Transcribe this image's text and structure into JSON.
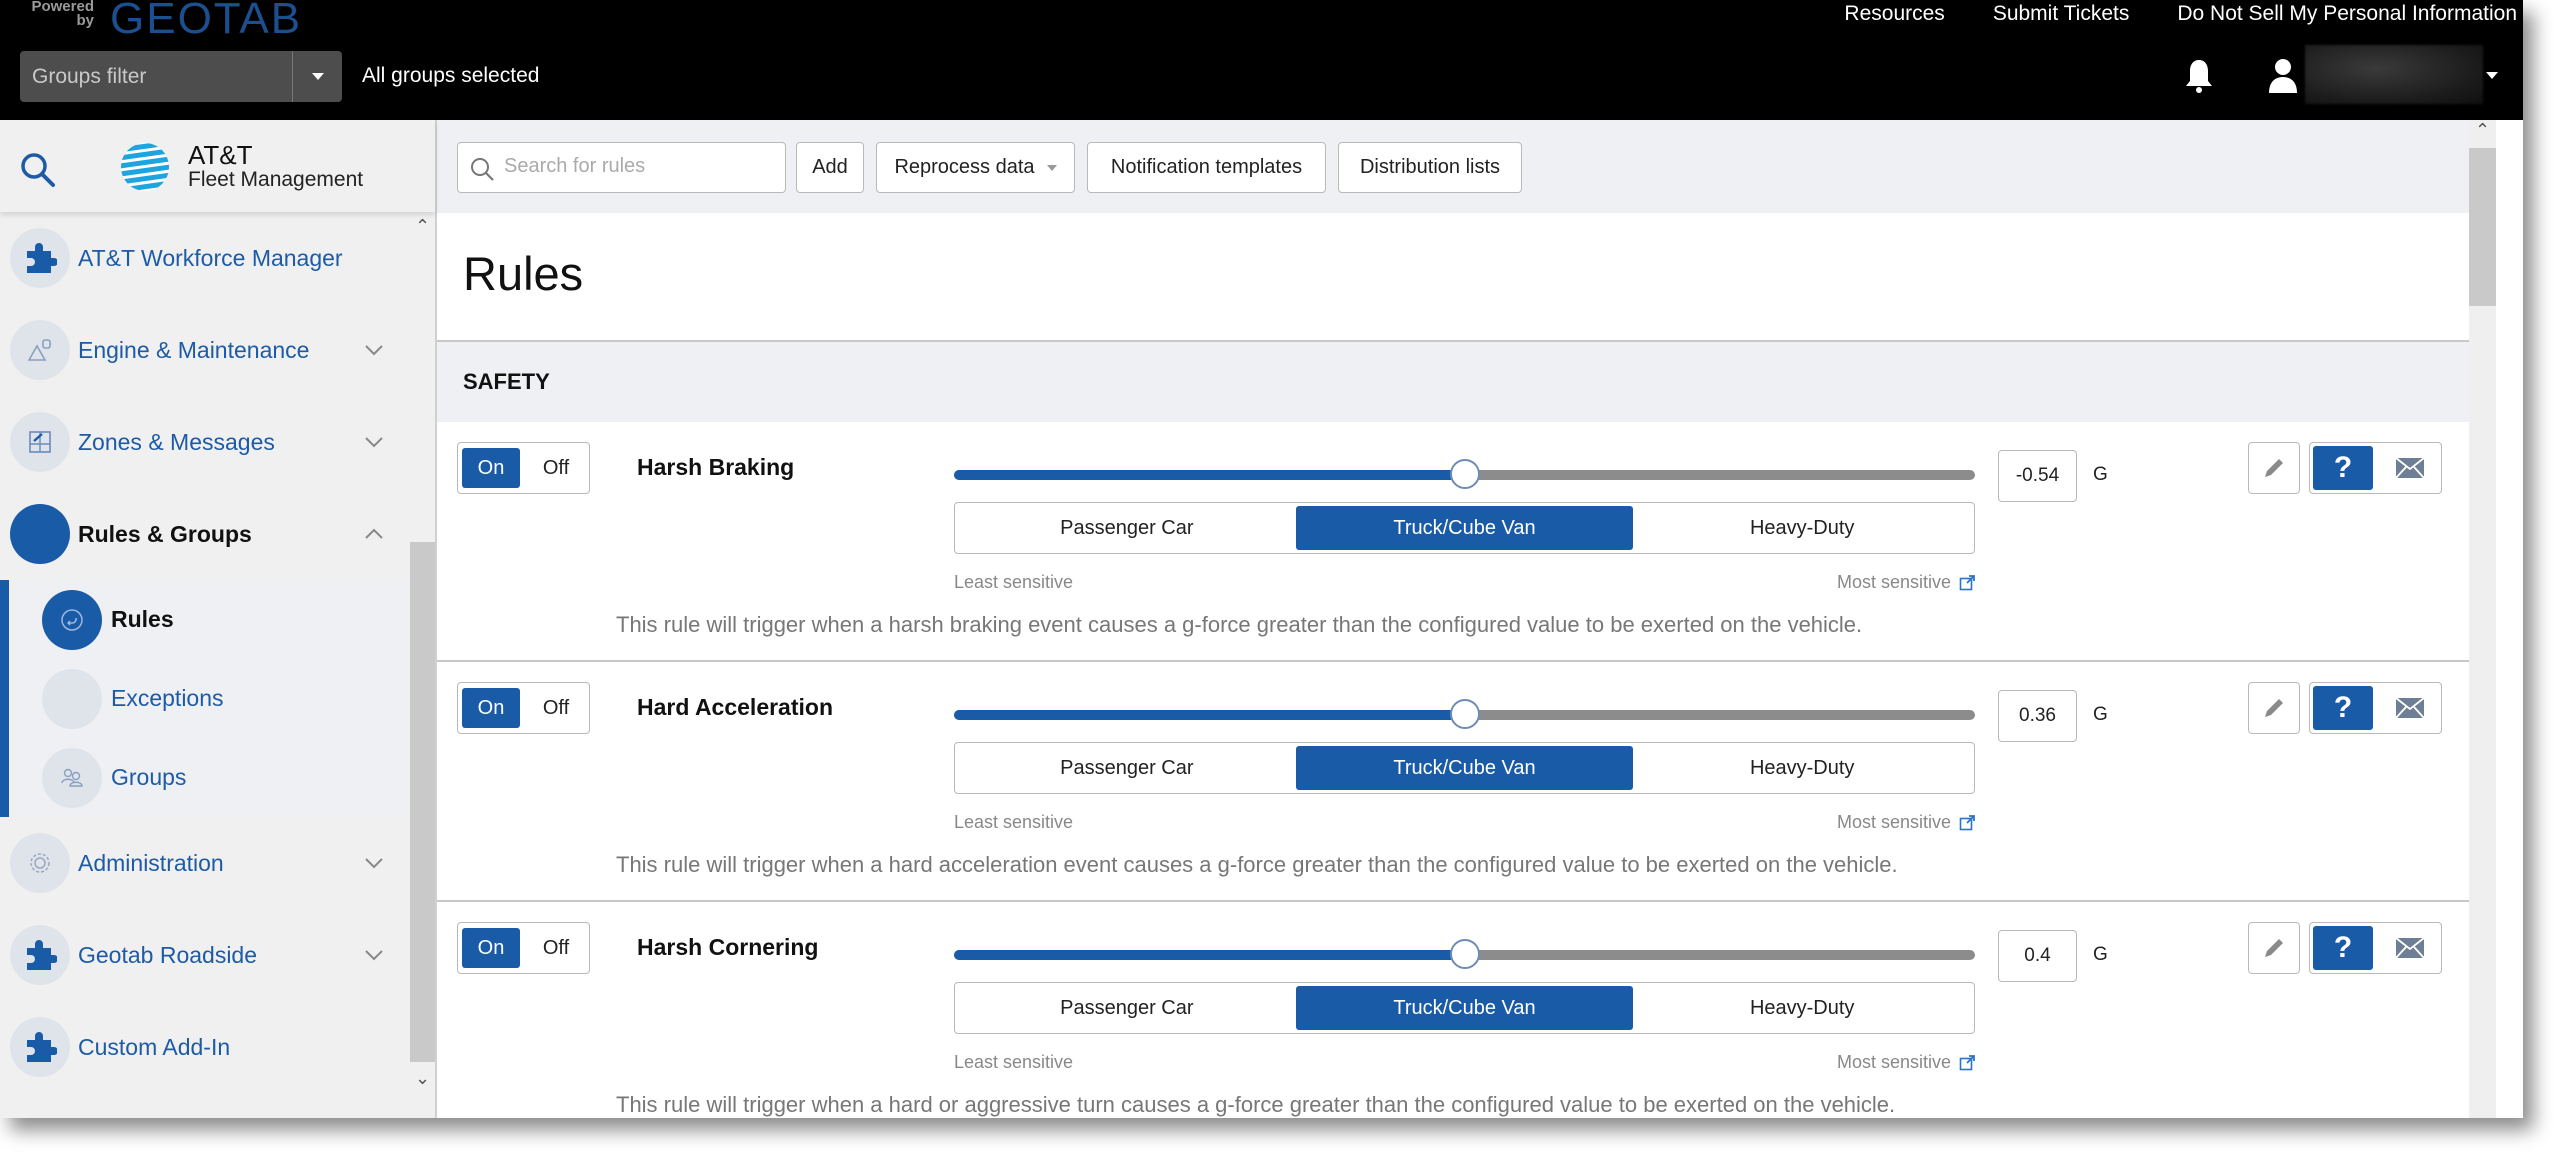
{
  "topbar": {
    "powered_by": "Powered by",
    "brand": "GEOTAB",
    "groups_filter_placeholder": "Groups filter",
    "groups_selected": "All groups selected",
    "links": [
      "Resources",
      "Submit Tickets",
      "Do Not Sell My Personal Information"
    ],
    "icons": {
      "notifications": "bell-icon",
      "user": "user-icon",
      "user_menu": "caret-down-icon"
    }
  },
  "sidebar": {
    "logo_title": "AT&T",
    "logo_subtitle": "Fleet Management",
    "items": [
      {
        "label": "AT&T Workforce Manager",
        "icon": "puzzle-icon",
        "expandable": false
      },
      {
        "label": "Engine & Maintenance",
        "icon": "engine-warning-icon",
        "expandable": true
      },
      {
        "label": "Zones & Messages",
        "icon": "zones-map-icon",
        "expandable": true
      },
      {
        "label": "Rules & Groups",
        "icon": "rules-groups-icon",
        "expandable": true,
        "expanded": true,
        "active": true,
        "children": [
          {
            "label": "Rules",
            "icon": "rules-icon",
            "active": true
          },
          {
            "label": "Exceptions",
            "icon": "exceptions-icon",
            "active": false
          },
          {
            "label": "Groups",
            "icon": "groups-icon",
            "active": false
          }
        ]
      },
      {
        "label": "Administration",
        "icon": "gear-icon",
        "expandable": true
      },
      {
        "label": "Geotab Roadside",
        "icon": "puzzle-icon",
        "expandable": true
      },
      {
        "label": "Custom Add-In",
        "icon": "puzzle-icon",
        "expandable": false
      }
    ]
  },
  "toolbar": {
    "search_placeholder": "Search for rules",
    "search_value": "",
    "add_label": "Add",
    "reprocess_label": "Reprocess data",
    "notification_templates_label": "Notification templates",
    "distribution_lists_label": "Distribution lists"
  },
  "page": {
    "title": "Rules",
    "section": "SAFETY"
  },
  "rules": [
    {
      "name": "Harsh Braking",
      "on_label": "On",
      "off_label": "Off",
      "enabled": true,
      "slider_fraction": 0.5,
      "value": "-0.54",
      "unit": "G",
      "vehicle_types": [
        "Passenger Car",
        "Truck/Cube Van",
        "Heavy-Duty"
      ],
      "selected_vehicle": 1,
      "least_label": "Least sensitive",
      "most_label": "Most sensitive",
      "description": "This rule will trigger when a harsh braking event causes a g-force greater than the configured value to be exerted on the vehicle."
    },
    {
      "name": "Hard Acceleration",
      "on_label": "On",
      "off_label": "Off",
      "enabled": true,
      "slider_fraction": 0.5,
      "value": "0.36",
      "unit": "G",
      "vehicle_types": [
        "Passenger Car",
        "Truck/Cube Van",
        "Heavy-Duty"
      ],
      "selected_vehicle": 1,
      "least_label": "Least sensitive",
      "most_label": "Most sensitive",
      "description": "This rule will trigger when a hard acceleration event causes a g-force greater than the configured value to be exerted on the vehicle."
    },
    {
      "name": "Harsh Cornering",
      "on_label": "On",
      "off_label": "Off",
      "enabled": true,
      "slider_fraction": 0.5,
      "value": "0.4",
      "unit": "G",
      "vehicle_types": [
        "Passenger Car",
        "Truck/Cube Van",
        "Heavy-Duty"
      ],
      "selected_vehicle": 1,
      "least_label": "Least sensitive",
      "most_label": "Most sensitive",
      "description": "This rule will trigger when a hard or aggressive turn causes a g-force greater than the configured value to be exerted on the vehicle."
    }
  ],
  "help_label": "?",
  "colors": {
    "accent": "#1a5ba8",
    "topbar": "#000000",
    "sidebar_bg": "#f0f0f0",
    "toolbar_bg": "#eef0f4"
  }
}
